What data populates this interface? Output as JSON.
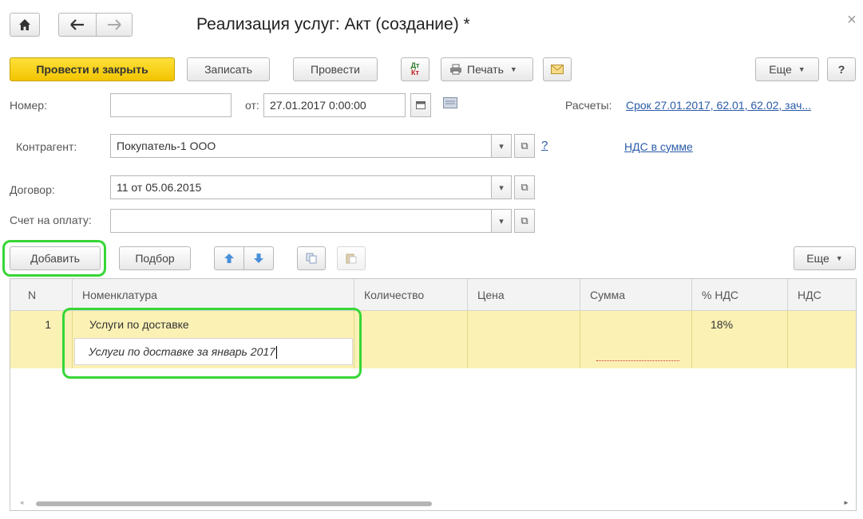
{
  "nav": {
    "home_icon": "home-icon",
    "back_icon": "arrow-left-icon",
    "forward_icon": "arrow-right-icon"
  },
  "window": {
    "title": "Реализация услуг: Акт (создание) *",
    "close": "×"
  },
  "toolbar": {
    "post_close": "Провести и закрыть",
    "save": "Записать",
    "post": "Провести",
    "dt_kt_top": "Дт",
    "dt_kt_bottom": "Кт",
    "print": "Печать",
    "more": "Еще",
    "help": "?"
  },
  "header": {
    "number_label": "Номер:",
    "number_value": "",
    "date_label": "от:",
    "date_value": "27.01.2017  0:00:00",
    "settlements_label": "Расчеты:",
    "settlements_link": "Срок 27.01.2017, 62.01, 62.02, зач..."
  },
  "fields": {
    "contractor_label": "Контрагент:",
    "contractor_value": "Покупатель-1 ООО",
    "contractor_help": "?",
    "vat_link": "НДС в сумме",
    "contract_label": "Договор:",
    "contract_value": "11 от 05.06.2015",
    "invoice_label": "Счет на оплату:",
    "invoice_value": ""
  },
  "table_toolbar": {
    "add": "Добавить",
    "select": "Подбор",
    "more": "Еще"
  },
  "table": {
    "columns": [
      "N",
      "Номенклатура",
      "Количество",
      "Цена",
      "Сумма",
      "% НДС",
      "НДС"
    ],
    "rows": [
      {
        "n": "1",
        "item": "Услуги по доставке",
        "item_content": "Услуги по доставке за январь 2017",
        "qty": "",
        "price": "",
        "sum": "",
        "vat_rate": "18%",
        "vat": ""
      }
    ]
  },
  "colors": {
    "primary": "#f2c400",
    "row_highlight": "#fbf1b4",
    "focus_outline": "#36d636",
    "link": "#2a5ba8"
  }
}
